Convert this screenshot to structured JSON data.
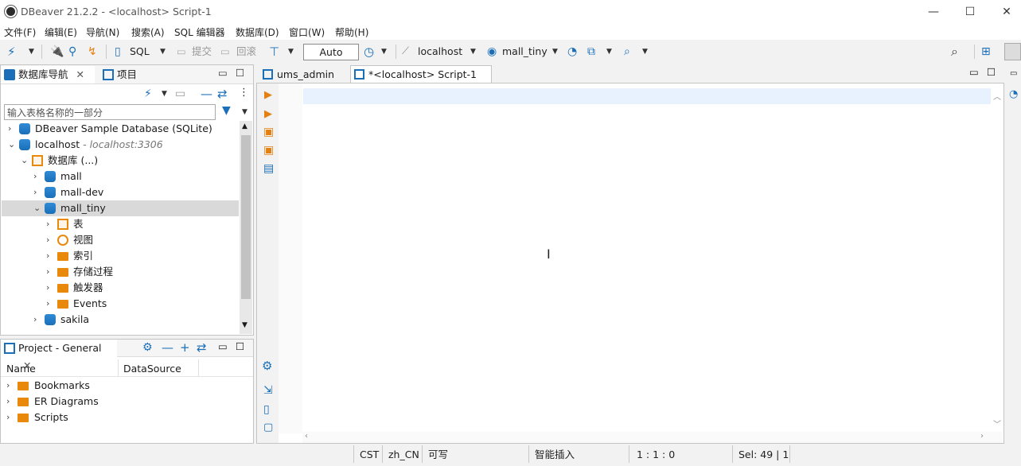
{
  "window": {
    "title": "DBeaver 21.2.2 - <localhost> Script-1",
    "minimize": "—",
    "maximize": "☐",
    "close": "✕"
  },
  "menu": [
    "文件(F)",
    "编辑(E)",
    "导航(N)",
    "搜索(A)",
    "SQL 编辑器",
    "数据库(D)",
    "窗口(W)",
    "帮助(H)"
  ],
  "toolbar": {
    "sql_label": "SQL",
    "commit_label": "提交",
    "rollback_label": "回滚",
    "transaction_mode": "Auto",
    "connection": "localhost",
    "schema": "mall_tiny"
  },
  "navigator": {
    "tabs": [
      "数据库导航",
      "项目"
    ],
    "filter_placeholder": "输入表格名称的一部分",
    "tree": [
      {
        "label": "DBeaver Sample Database (SQLite)",
        "sublabel": "",
        "level": 0,
        "expanded": false,
        "icon": "sqlite-db-icon"
      },
      {
        "label": "localhost",
        "sublabel": " - localhost:3306",
        "level": 0,
        "expanded": true,
        "icon": "mysql-connection-icon"
      },
      {
        "label": "数据库 (...)",
        "sublabel": "",
        "level": 1,
        "expanded": true,
        "icon": "databases-folder-icon"
      },
      {
        "label": "mall",
        "sublabel": "",
        "level": 2,
        "expanded": false,
        "icon": "database-icon"
      },
      {
        "label": "mall-dev",
        "sublabel": "",
        "level": 2,
        "expanded": false,
        "icon": "database-icon"
      },
      {
        "label": "mall_tiny",
        "sublabel": "",
        "level": 2,
        "expanded": true,
        "icon": "database-icon",
        "selected": true
      },
      {
        "label": "表",
        "sublabel": "",
        "level": 3,
        "expanded": false,
        "icon": "tables-icon"
      },
      {
        "label": "视图",
        "sublabel": "",
        "level": 3,
        "expanded": false,
        "icon": "views-icon"
      },
      {
        "label": "索引",
        "sublabel": "",
        "level": 3,
        "expanded": false,
        "icon": "folder-icon"
      },
      {
        "label": "存储过程",
        "sublabel": "",
        "level": 3,
        "expanded": false,
        "icon": "folder-icon"
      },
      {
        "label": "触发器",
        "sublabel": "",
        "level": 3,
        "expanded": false,
        "icon": "folder-icon"
      },
      {
        "label": "Events",
        "sublabel": "",
        "level": 3,
        "expanded": false,
        "icon": "folder-icon"
      },
      {
        "label": "sakila",
        "sublabel": "",
        "level": 2,
        "expanded": false,
        "icon": "database-icon"
      }
    ]
  },
  "project": {
    "tab": "Project - General",
    "columns": [
      "Name",
      "DataSource"
    ],
    "items": [
      "Bookmarks",
      "ER Diagrams",
      "Scripts"
    ]
  },
  "editor": {
    "tabs": [
      "ums_admin",
      "*<localhost> Script-1"
    ],
    "active_tab": 1
  },
  "status": {
    "timezone": "CST",
    "locale": "zh_CN",
    "mode": "可写",
    "insert_mode": "智能插入",
    "position": "1 : 1 : 0",
    "selection": "Sel: 49 | 1"
  },
  "colors": {
    "accent_blue": "#1b6fb8",
    "accent_orange": "#e4800f",
    "selection_bg": "#d9d9d9",
    "current_line_bg": "#e8f2fe"
  }
}
